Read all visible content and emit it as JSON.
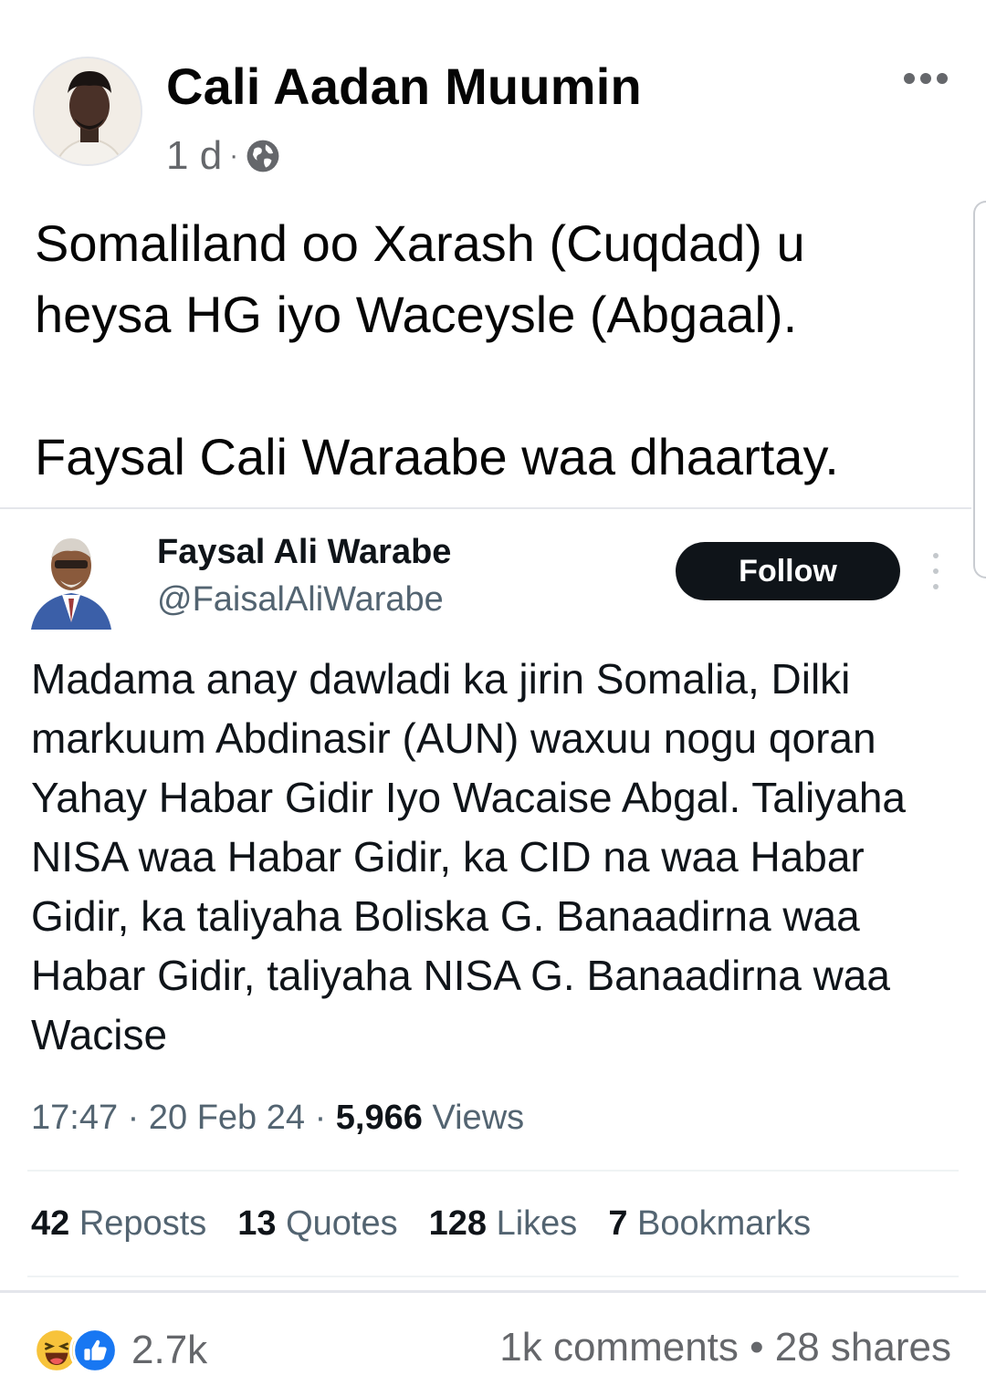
{
  "post": {
    "author": "Cali Aadan Muumin",
    "time": "1 d",
    "separator": "·",
    "privacy_icon": "globe-icon",
    "text_lines": [
      "Somaliland oo Xarash (Cuqdad) u",
      "heysa HG iyo Waceysle (Abgaal).",
      "Faysal Cali Waraabe waa dhaartay."
    ]
  },
  "tweet": {
    "name": "Faysal Ali Warabe",
    "handle": "@FaisalAliWarabe",
    "follow_label": "Follow",
    "text": "Madama anay dawladi ka jirin Somalia, Dilki markuum Abdinasir (AUN) waxuu nogu qoran Yahay Habar Gidir Iyo Wacaise Abgal. Taliyaha NISA waa Habar Gidir, ka CID na waa Habar Gidir, ka taliyaha Boliska G. Banaadirna waa Habar Gidir, taliyaha NISA G. Banaadirna  waa  Wacise",
    "time": "17:47",
    "date": "20 Feb 24",
    "views_count": "5,966",
    "views_label": "Views",
    "stats": [
      {
        "count": "42",
        "label": "Reposts"
      },
      {
        "count": "13",
        "label": "Quotes"
      },
      {
        "count": "128",
        "label": "Likes"
      },
      {
        "count": "7",
        "label": "Bookmarks"
      }
    ]
  },
  "footer": {
    "reaction_icons": [
      "haha-reaction-icon",
      "like-reaction-icon"
    ],
    "reaction_count": "2.7k",
    "comments": "1k comments",
    "shares": "28 shares",
    "bullet": "•"
  },
  "colors": {
    "text_primary": "#050505",
    "text_secondary": "#65676b",
    "twitter_secondary": "#536471",
    "follow_bg": "#0f1419",
    "like_blue": "#1877f2",
    "haha_yellow": "#f7c33b"
  }
}
